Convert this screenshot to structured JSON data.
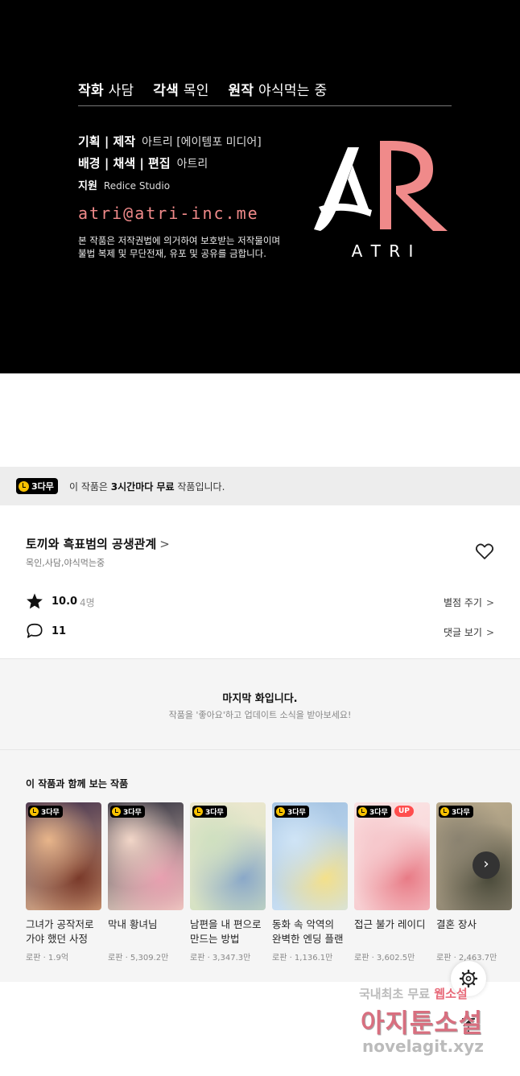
{
  "credits": {
    "top_items": [
      {
        "role": "작화",
        "name": "사담"
      },
      {
        "role": "각색",
        "name": "목인"
      },
      {
        "role": "원작",
        "name": "야식먹는 중"
      }
    ],
    "rows": [
      {
        "role": "기획 | 제작",
        "name": "아트리 [에이템포 미디어]"
      },
      {
        "role": "배경 | 채색 | 편집",
        "name": "아트리"
      },
      {
        "role": "지원",
        "name": "Redice Studio"
      }
    ],
    "email": "atri@atri-inc.me",
    "notice_line1": "본 작품은 저작권법에 의거하여 보호받는 저작물이며",
    "notice_line2": "불법 복제 및 무단전재, 유포 및 공유를 금합니다.",
    "logo_letters": "AR",
    "logo_caption": "A  T  R  I",
    "logo_colors": {
      "white": "#ffffff",
      "salmon": "#f08a8a"
    }
  },
  "free_banner": {
    "badge": "3다무",
    "text_prefix": "이 작품은 ",
    "text_bold": "3시간마다 무료",
    "text_suffix": " 작품입니다."
  },
  "work": {
    "title": "토끼와 흑표범의 공생관계",
    "title_chevron": ">",
    "authors": "목인,사담,야식먹는중",
    "rating": "10.0",
    "rating_count": "4명",
    "rate_action": "별점 주기",
    "comments": "11",
    "comment_action": "댓글 보기",
    "chevron": ">"
  },
  "last_episode": {
    "heading": "마지막 화입니다.",
    "sub": "작품을 '좋아요'하고 업데이트 소식을 받아보세요!"
  },
  "recommend": {
    "title": "이 작품과 함께 보는 작품",
    "badge": "3다무",
    "up_label": "UP",
    "next_icon": "›",
    "items": [
      {
        "title_line1": "그녀가 공작저로",
        "title_line2": "가야 했던 사정",
        "meta": "로판 · 1.9억",
        "up": false,
        "colors": [
          "#e8b58a",
          "#7a3a2a",
          "#3a2a4a"
        ]
      },
      {
        "title_line1": "막내 황녀님",
        "title_line2": "",
        "meta": "로판 · 5,309.2만",
        "up": false,
        "colors": [
          "#f2d6c8",
          "#e8a0b0",
          "#2b2b3a"
        ]
      },
      {
        "title_line1": "남편을 내 편으로",
        "title_line2": "만드는 방법",
        "meta": "로판 · 3,347.3만",
        "up": false,
        "colors": [
          "#cfe0c0",
          "#8aa8c8",
          "#f0e8d0"
        ]
      },
      {
        "title_line1": "동화 속 악역의",
        "title_line2": "완벽한 엔딩 플랜",
        "meta": "로판 · 1,136.1만",
        "up": false,
        "colors": [
          "#cfe4f6",
          "#f4e08a",
          "#a0c0e0"
        ]
      },
      {
        "title_line1": "접근 불가 레이디",
        "title_line2": "",
        "meta": "로판 · 3,602.5만",
        "up": true,
        "colors": [
          "#f6c8cc",
          "#e87b86",
          "#fbe6e6"
        ]
      },
      {
        "title_line1": "결혼 장사",
        "title_line2": "",
        "meta": "로판 · 2,463.7만",
        "up": false,
        "colors": [
          "#8a8270",
          "#4a4a3a",
          "#c0b090"
        ]
      }
    ]
  },
  "watermark": {
    "line1_a": "국내최초 무료",
    "line1_b": "웹소설",
    "line2": "아지툰소설",
    "line3": "novelagit.xyz"
  }
}
